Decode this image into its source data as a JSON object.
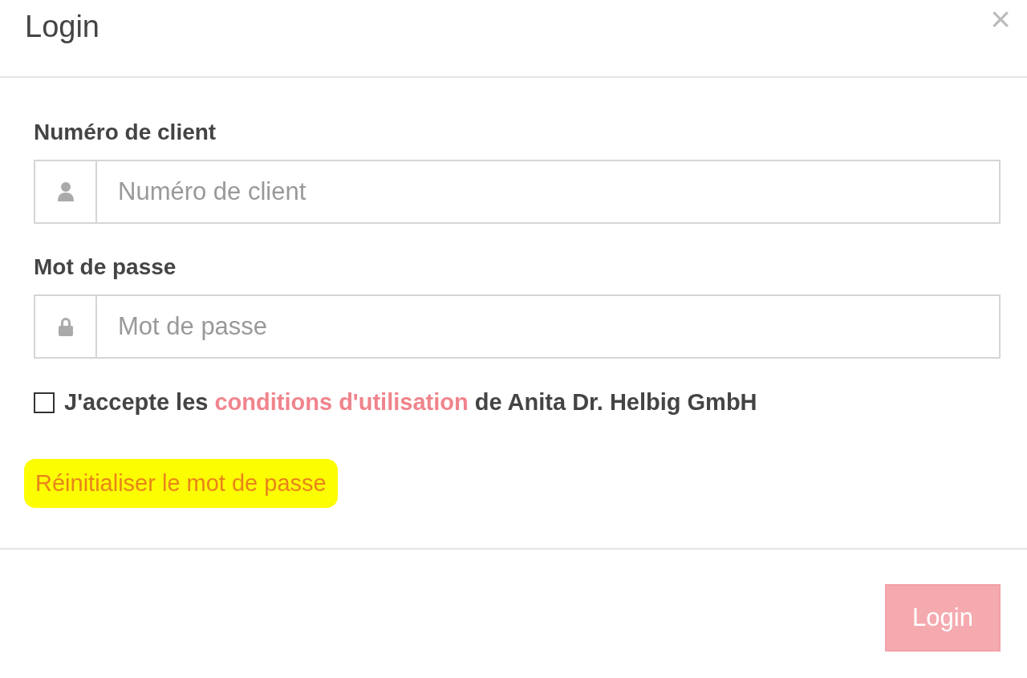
{
  "dialog": {
    "title": "Login",
    "close": "×"
  },
  "fields": [
    {
      "label": "Numéro de client",
      "kind": "user",
      "placeholder": "Numéro de client"
    },
    {
      "label": "Mot de passe",
      "kind": "password",
      "placeholder": "Mot de passe"
    }
  ],
  "terms": {
    "checked": false,
    "before": "J'accepte les",
    "link": "conditions d'utilisation",
    "after": "de Anita Dr. Helbig GmbH"
  },
  "reset_link": {
    "label": "Réinitialiser le mot de passe",
    "highlighted": true
  },
  "submit": {
    "label": "Login",
    "disabled": true
  }
}
